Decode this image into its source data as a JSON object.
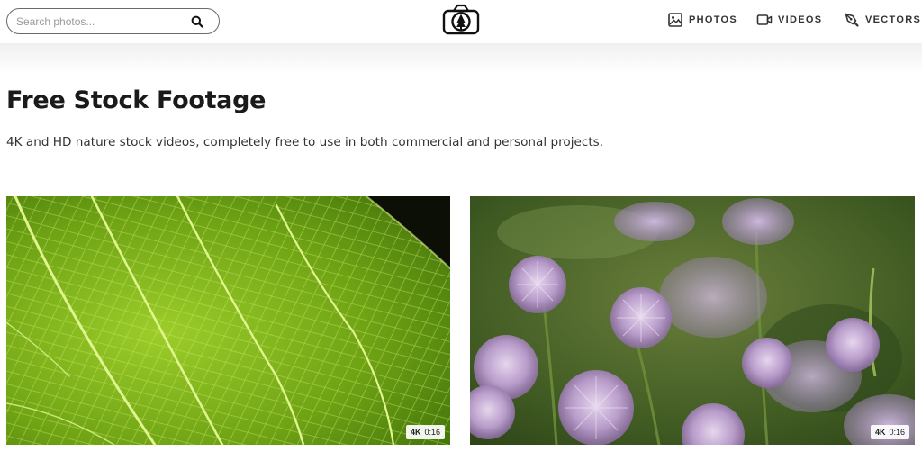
{
  "search": {
    "placeholder": "Search photos..."
  },
  "nav": {
    "photos": "PHOTOS",
    "videos": "VIDEOS",
    "vectors": "VECTORS"
  },
  "page": {
    "title": "Free Stock Footage",
    "subtitle": "4K and HD nature stock videos, completely free to use in both commercial and personal projects."
  },
  "videos": [
    {
      "thumbnail": "green-leaf-closeup",
      "quality": "4K",
      "duration": "0:16"
    },
    {
      "thumbnail": "purple-chive-flowers",
      "quality": "4K",
      "duration": "0:16"
    }
  ],
  "icons": {
    "search": "search-icon",
    "logo": "camera-tree-logo",
    "photos": "image-icon",
    "videos": "video-camera-icon",
    "vectors": "pen-tool-icon"
  }
}
